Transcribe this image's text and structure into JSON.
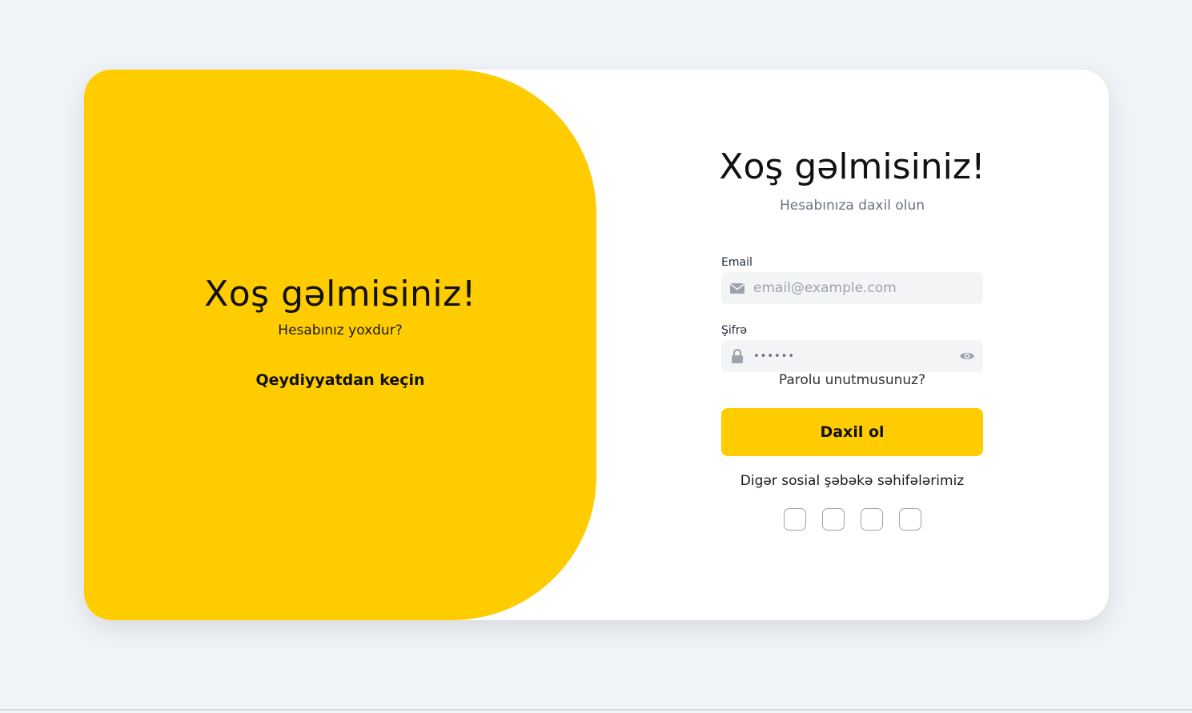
{
  "left_panel": {
    "title": "Xoş gəlmisiniz!",
    "subtitle": "Hesabınız yoxdur?",
    "register_label": "Qeydiyyatdan keçin",
    "color": "#ffcc00"
  },
  "form": {
    "title": "Xoş gəlmisiniz!",
    "subtitle": "Hesabınıza daxil olun",
    "email": {
      "label": "Email",
      "placeholder": "email@example.com",
      "icon": "envelope-icon"
    },
    "password": {
      "label": "Şifrə",
      "value": "••••••",
      "icon": "lock-icon",
      "toggle_icon": "eye-icon"
    },
    "forgot_label": "Parolu unutmusunuz?",
    "submit_label": "Daxil ol",
    "social_label": "Digər sosial şəbəkə səhifələrimiz",
    "social_buttons": [
      "social-button-1",
      "social-button-2",
      "social-button-3",
      "social-button-4"
    ]
  }
}
